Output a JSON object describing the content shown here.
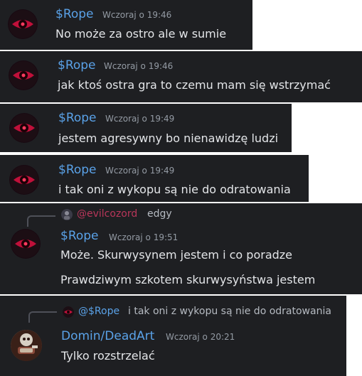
{
  "colors": {
    "background": "#1e1f22",
    "username_rope": "#5aa2e8",
    "username_evil": "#b8365a",
    "timestamp": "#949ba4",
    "message_text": "#e3e5e8"
  },
  "messages": [
    {
      "author": "$Rope",
      "timestamp": "Wczoraj o 19:46",
      "text": "No może za ostro ale w sumie",
      "avatar": "red-eye-avatar"
    },
    {
      "author": "$Rope",
      "timestamp": "Wczoraj o 19:46",
      "text": "jak ktoś ostra gra to czemu mam się wstrzymać",
      "avatar": "red-eye-avatar"
    },
    {
      "author": "$Rope",
      "timestamp": "Wczoraj o 19:49",
      "text": "jestem agresywny bo nienawidzę ludzi",
      "avatar": "red-eye-avatar"
    },
    {
      "author": "$Rope",
      "timestamp": "Wczoraj o 19:49",
      "text": "i tak oni z wykopu są nie do odratowania",
      "avatar": "red-eye-avatar"
    },
    {
      "reply": {
        "author": "@evilcozord",
        "text": "edgy",
        "avatar": "dark-avatar"
      },
      "author": "$Rope",
      "timestamp": "Wczoraj o 19:51",
      "lines": [
        "Może. Skurwysynem jestem i co poradze",
        "Prawdziwym szkotem skurwysyństwa jestem"
      ],
      "avatar": "red-eye-avatar"
    },
    {
      "reply": {
        "author": "@$Rope",
        "text": "i tak oni z wykopu są nie do odratowania",
        "avatar": "red-eye-avatar"
      },
      "author": "Domin/DeadArt",
      "timestamp": "Wczoraj o 20:21",
      "text": "Tylko rozstrzelać",
      "avatar": "skull-art-avatar"
    }
  ]
}
